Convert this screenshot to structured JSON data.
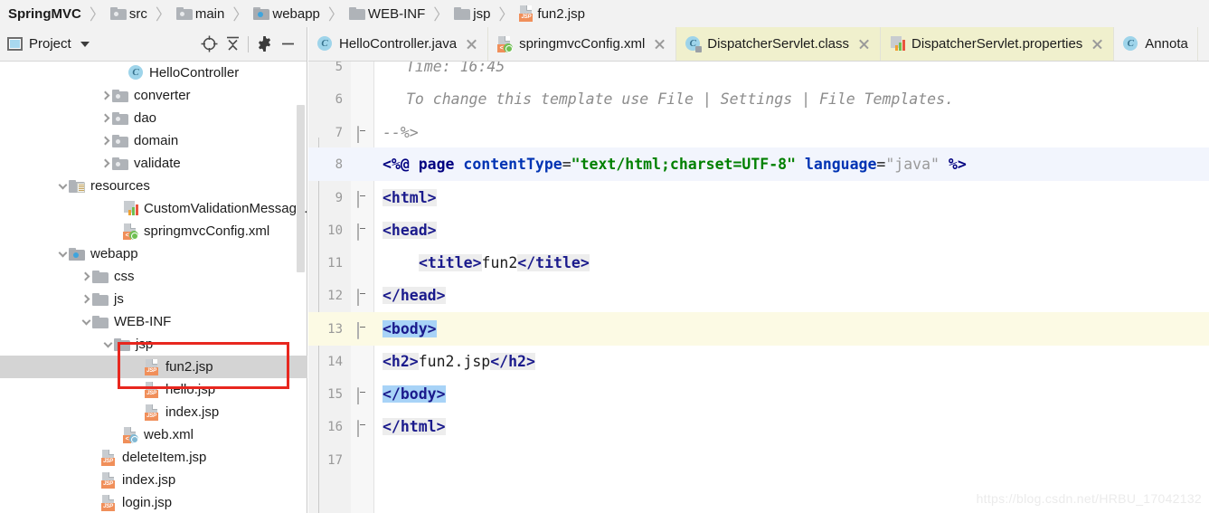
{
  "breadcrumb": {
    "separator": "〉",
    "items": [
      {
        "label": "SpringMVC",
        "icon": "none",
        "root": true
      },
      {
        "label": "src",
        "icon": "folder-icon"
      },
      {
        "label": "main",
        "icon": "folder-icon"
      },
      {
        "label": "webapp",
        "icon": "webapp-folder-icon"
      },
      {
        "label": "WEB-INF",
        "icon": "folder-icon"
      },
      {
        "label": "jsp",
        "icon": "folder-icon"
      },
      {
        "label": "fun2.jsp",
        "icon": "jsp-file-icon"
      }
    ]
  },
  "project_panel": {
    "title": "Project",
    "dropdown_icon": "chevron-down-icon",
    "toolbar": [
      {
        "name": "locate-in-tree-icon",
        "glyph": "target-icon"
      },
      {
        "name": "collapse-all-icon",
        "glyph": "collapse-icon"
      },
      {
        "name": "settings-gear-icon",
        "glyph": "gear-icon"
      },
      {
        "name": "hide-panel-icon",
        "glyph": "minus-icon"
      }
    ],
    "tree": [
      {
        "label": "HelloController",
        "indent": 6,
        "arrow": "none",
        "icon": "java-class-icon",
        "selected": false
      },
      {
        "label": "converter",
        "indent": 4,
        "arrow": "right",
        "icon": "package-folder-icon",
        "selected": false
      },
      {
        "label": "dao",
        "indent": 4,
        "arrow": "right",
        "icon": "package-folder-icon",
        "selected": false
      },
      {
        "label": "domain",
        "indent": 4,
        "arrow": "right",
        "icon": "package-folder-icon",
        "selected": false
      },
      {
        "label": "validate",
        "indent": 4,
        "arrow": "right",
        "icon": "package-folder-icon",
        "selected": false
      },
      {
        "label": "resources",
        "indent": 3,
        "arrow": "down",
        "icon": "resources-folder-icon",
        "selected": false
      },
      {
        "label": "CustomValidationMessage.",
        "indent": 5,
        "arrow": "none",
        "icon": "properties-icon",
        "selected": false
      },
      {
        "label": "springmvcConfig.xml",
        "indent": 5,
        "arrow": "none",
        "icon": "spring-xml-icon",
        "selected": false
      },
      {
        "label": "webapp",
        "indent": 3,
        "arrow": "down",
        "icon": "webapp-folder-icon",
        "selected": false
      },
      {
        "label": "css",
        "indent": 4,
        "arrow": "right",
        "icon": "folder-icon",
        "selected": false
      },
      {
        "label": "js",
        "indent": 4,
        "arrow": "right",
        "icon": "folder-icon",
        "selected": false
      },
      {
        "label": "WEB-INF",
        "indent": 4,
        "arrow": "down",
        "icon": "folder-icon",
        "selected": false
      },
      {
        "label": "jsp",
        "indent": 5,
        "arrow": "down",
        "icon": "folder-icon",
        "selected": false
      },
      {
        "label": "fun2.jsp",
        "indent": 7,
        "arrow": "none",
        "icon": "jsp-file-icon",
        "selected": true
      },
      {
        "label": "hello.jsp",
        "indent": 7,
        "arrow": "none",
        "icon": "jsp-file-icon",
        "selected": false
      },
      {
        "label": "index.jsp",
        "indent": 7,
        "arrow": "none",
        "icon": "jsp-file-icon",
        "selected": false
      },
      {
        "label": "web.xml",
        "indent": 6,
        "arrow": "none",
        "icon": "web-xml-icon",
        "selected": false
      },
      {
        "label": "deleteItem.jsp",
        "indent": 5,
        "arrow": "none",
        "icon": "jsp-file-icon",
        "selected": false
      },
      {
        "label": "index.jsp",
        "indent": 5,
        "arrow": "none",
        "icon": "jsp-file-icon",
        "selected": false
      },
      {
        "label": "login.jsp",
        "indent": 5,
        "arrow": "none",
        "icon": "jsp-file-icon",
        "selected": false
      }
    ]
  },
  "editor_tabs": [
    {
      "label": "HelloController.java",
      "icon": "java-class-icon",
      "style": "plain",
      "closable": true
    },
    {
      "label": "springmvcConfig.xml",
      "icon": "spring-xml-icon",
      "style": "plain",
      "closable": true
    },
    {
      "label": "DispatcherServlet.class",
      "icon": "java-class-icon",
      "style": "yellow",
      "closable": true,
      "active": true
    },
    {
      "label": "DispatcherServlet.properties",
      "icon": "properties-icon",
      "style": "yellow",
      "closable": true
    },
    {
      "label": "Annota",
      "icon": "java-class-icon",
      "style": "plain",
      "closable": false
    }
  ],
  "editor": {
    "filename": "fun2.jsp",
    "lines": [
      {
        "number": "5",
        "fold": "none",
        "row": "none",
        "text": "  Time: 16:45"
      },
      {
        "number": "6",
        "fold": "none",
        "row": "none",
        "text": "  To change this template use File | Settings | File Templates."
      },
      {
        "number": "7",
        "fold": "close",
        "row": "none",
        "text": "--%>"
      },
      {
        "number": "8",
        "fold": "none",
        "row": "blue",
        "text": "<%@ page contentType=\"text/html;charset=UTF-8\" language=\"java\" %>"
      },
      {
        "number": "9",
        "fold": "open",
        "row": "none",
        "text": "<html>"
      },
      {
        "number": "10",
        "fold": "open",
        "row": "none",
        "text": "<head>"
      },
      {
        "number": "11",
        "fold": "none",
        "row": "none",
        "text": "    <title>fun2</title>"
      },
      {
        "number": "12",
        "fold": "close",
        "row": "none",
        "text": "</head>"
      },
      {
        "number": "13",
        "fold": "open",
        "row": "caret",
        "text": "<body>"
      },
      {
        "number": "14",
        "fold": "none",
        "row": "none",
        "text": "<h2>fun2.jsp</h2>"
      },
      {
        "number": "15",
        "fold": "close",
        "row": "none",
        "text": "</body>"
      },
      {
        "number": "16",
        "fold": "close",
        "row": "none",
        "text": "</html>"
      },
      {
        "number": "17",
        "fold": "none",
        "row": "none",
        "text": ""
      }
    ],
    "line5_text": "Time: 16:45",
    "line6_text": "To change this template use File | Settings | File Templates.",
    "line7_text": "--%>",
    "line8": {
      "open": "<%@ ",
      "tag": "page",
      "attr1": " contentType",
      "eq1": "=",
      "val1": "\"text/html;charset=UTF-8\"",
      "attr2": " language",
      "eq2": "=",
      "val2": "\"java\"",
      "close": " %>"
    },
    "line9_text": "<html>",
    "line10_text": "<head>",
    "line11_open": "<title>",
    "line11_content": "fun2",
    "line11_close": "</title>",
    "line12_text": "</head>",
    "line13_text": "<body>",
    "line14_open": "<h2>",
    "line14_content": "fun2.jsp",
    "line14_close": "</h2>",
    "line15_text": "</body>",
    "line16_text": "</html>"
  },
  "annotation": {
    "name": "red-highlight-box",
    "color": "#e8271f"
  },
  "watermark": {
    "text": "https://blog.csdn.net/HRBU_17042132"
  },
  "colors": {
    "caret_line": "#fcfae4",
    "directive_line": "#f2f5fd",
    "tag_highlight": "#ededed",
    "matching_tag": "#a8d3f7",
    "selection_row": "#d4d4d4",
    "tab_yellow": "#f0f0cd",
    "chrome": "#f2f2f2"
  }
}
